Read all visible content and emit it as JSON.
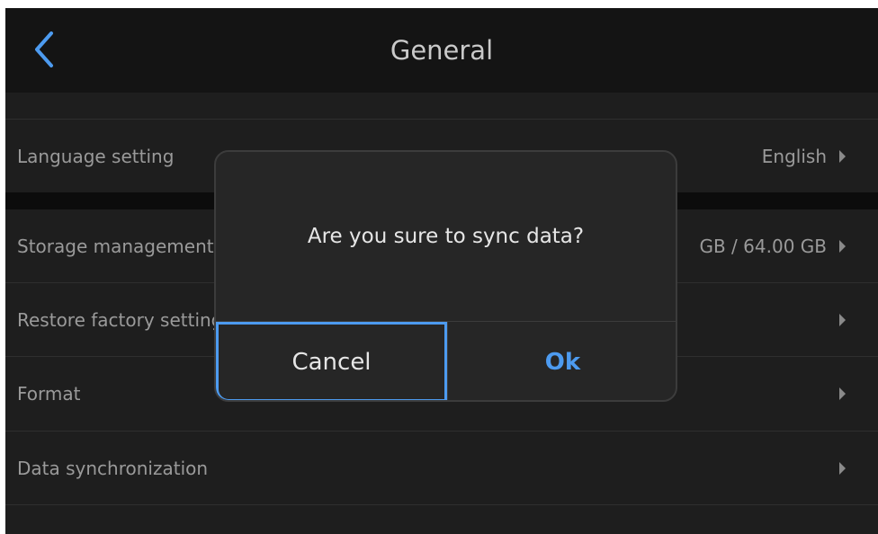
{
  "header": {
    "title": "General",
    "back_icon": "chevron-left-icon"
  },
  "settings": [
    {
      "label": "Language setting",
      "value": "English"
    },
    {
      "label": "Storage management",
      "value": "GB / 64.00 GB"
    },
    {
      "label": "Restore factory settings",
      "value": ""
    },
    {
      "label": "Format",
      "value": ""
    },
    {
      "label": "Data synchronization",
      "value": ""
    }
  ],
  "dialog": {
    "message": "Are you sure to sync data?",
    "cancel_label": "Cancel",
    "ok_label": "Ok"
  },
  "colors": {
    "accent": "#4d9bf0",
    "background": "#1e1e1e",
    "header": "#141414",
    "dialog": "#262626"
  }
}
